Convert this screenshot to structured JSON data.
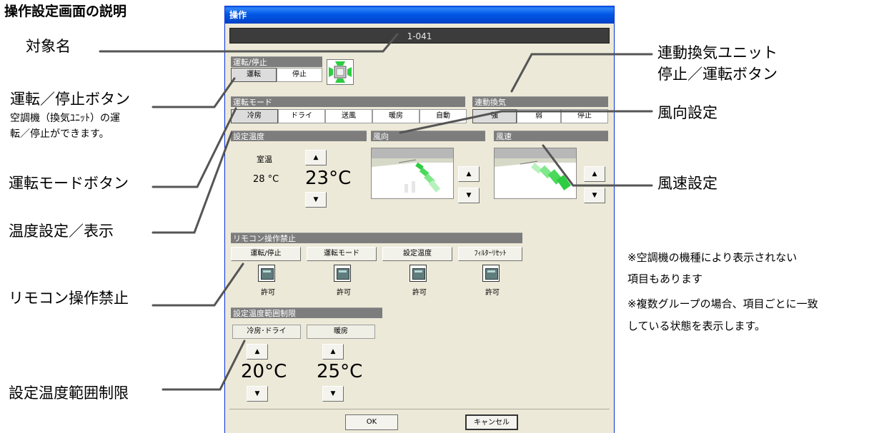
{
  "page": {
    "heading": "操作設定画面の説明"
  },
  "callouts": {
    "target_name": "対象名",
    "run_stop_button": "運転／停止ボタン",
    "run_stop_desc_1": "空調機（換気ﾕﾆｯﾄ）の運",
    "run_stop_desc_2": "転／停止ができます。",
    "mode_button": "運転モードボタン",
    "temp_setting": "温度設定／表示",
    "remote_prohibit": "リモコン操作禁止",
    "temp_range_limit": "設定温度範囲制限",
    "vent_unit_line1": "連動換気ユニット",
    "vent_unit_line2": "停止／運転ボタン",
    "wind_direction": "風向設定",
    "wind_speed": "風速設定"
  },
  "notes": {
    "line1": "※空調機の機種により表示されない",
    "line2": "項目もあります",
    "line3": "※複数グループの場合、項目ごとに一致",
    "line4": "している状態を表示します。"
  },
  "dialog": {
    "title": "操作",
    "target_name": "1-041",
    "run_stop": {
      "header": "運転/停止",
      "buttons": [
        "運転",
        "停止"
      ]
    },
    "mode": {
      "header": "運転モード",
      "buttons": [
        "冷房",
        "ドライ",
        "送風",
        "暖房",
        "自動"
      ]
    },
    "vent": {
      "header": "連動換気",
      "buttons": [
        "強",
        "弱",
        "停止"
      ]
    },
    "set_temp": {
      "header": "設定温度",
      "room_label": "室温",
      "room_value": "28 °C",
      "set_value": "23°C"
    },
    "wind_direction": {
      "header": "風向"
    },
    "wind_speed": {
      "header": "風速"
    },
    "remote_prohibit": {
      "header": "リモコン操作禁止",
      "items": [
        {
          "label": "運転/停止",
          "state": "許可"
        },
        {
          "label": "運転モード",
          "state": "許可"
        },
        {
          "label": "設定温度",
          "state": "許可"
        },
        {
          "label": "ﾌｨﾙﾀｰﾘｾｯﾄ",
          "state": "許可"
        }
      ]
    },
    "temp_range": {
      "header": "設定温度範囲制限",
      "cool_label": "冷房･ドライ",
      "heat_label": "暖房",
      "cool_value": "20°C",
      "heat_value": "25°C"
    },
    "ok_label": "OK",
    "cancel_label": "キャンセル"
  },
  "icons": {
    "up": "triangle-up",
    "down": "triangle-down",
    "ac_status": "green-fan-icon",
    "lock": "remote-lock-icon"
  },
  "colors": {
    "title_bar": "#0058e6",
    "section_header": "#7d7d7d",
    "dialog_bg": "#ece9d8",
    "active_green": "#2ecc40"
  }
}
